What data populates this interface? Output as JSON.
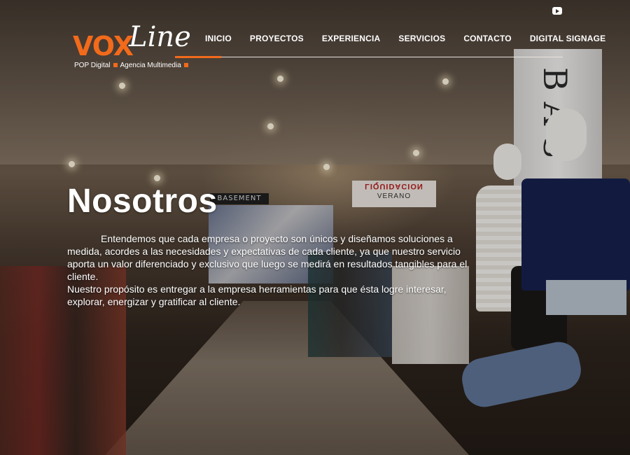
{
  "brand": {
    "logo_part1": "VOX",
    "logo_part2": "Line",
    "tagline_1": "POP Digital",
    "tagline_2": "Agencia Multimedia",
    "accent_color": "#f26a1b"
  },
  "nav": {
    "items": [
      {
        "label": "INICIO"
      },
      {
        "label": "PROYECTOS"
      },
      {
        "label": "EXPERIENCIA"
      },
      {
        "label": "SERVICIOS"
      },
      {
        "label": "CONTACTO"
      },
      {
        "label": "DIGITAL SIGNAGE"
      }
    ],
    "active": "INICIO",
    "social_icon": "youtube-icon"
  },
  "background": {
    "sign_basement": "BASEMENT",
    "sign_liquidacion": "LIQUIDACION",
    "sign_verano": "VERANO",
    "pillar_text": "BAS"
  },
  "content": {
    "title": "Nosotros",
    "paragraph_1": "Entendemos que cada empresa o proyecto son únicos y diseñamos soluciones a medida, acordes a las necesidades y expectativas de cada cliente, ya que nuestro servicio aporta un valor diferenciado y exclusivo que luego se medirá en resultados tangibles para el cliente.",
    "paragraph_2": "Nuestro propósito es entregar a la empresa herramientas para que ésta logre interesar, explorar, energizar y gratificar al cliente."
  }
}
